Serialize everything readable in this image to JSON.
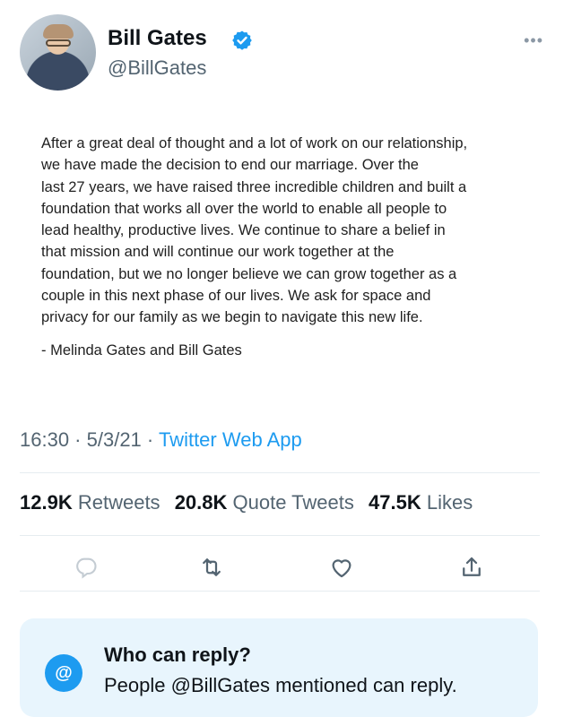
{
  "user": {
    "name": "Bill Gates",
    "handle": "@BillGates"
  },
  "tweet": {
    "lines": [
      "After a great deal of thought and a lot of work on our relationship,",
      "we have made the decision to end our marriage. Over the",
      "last 27 years, we have raised three incredible children and built a",
      "foundation that works all over the world to enable all people to",
      "lead healthy, productive lives. We continue to share a belief in",
      "that mission and will continue our work together at the",
      "foundation, but we no longer believe we can grow together as a",
      "couple in this next phase of our lives. We ask for space and",
      "privacy for our family as we begin to navigate this new life."
    ],
    "signature": "- Melinda Gates and Bill Gates"
  },
  "meta": {
    "time": "16:30",
    "sep1": " · ",
    "date": "5/3/21",
    "sep2": " · ",
    "source": "Twitter Web App"
  },
  "stats": {
    "retweets_count": "12.9K",
    "retweets_label": "Retweets",
    "quotes_count": "20.8K",
    "quotes_label": "Quote Tweets",
    "likes_count": "47.5K",
    "likes_label": "Likes"
  },
  "reply_settings": {
    "title": "Who can reply?",
    "subtitle": "People @BillGates mentioned can reply.",
    "badge": "@"
  },
  "colors": {
    "accent": "#1d9bf0",
    "text_secondary": "#536471",
    "reply_bg": "#e8f5fd"
  }
}
